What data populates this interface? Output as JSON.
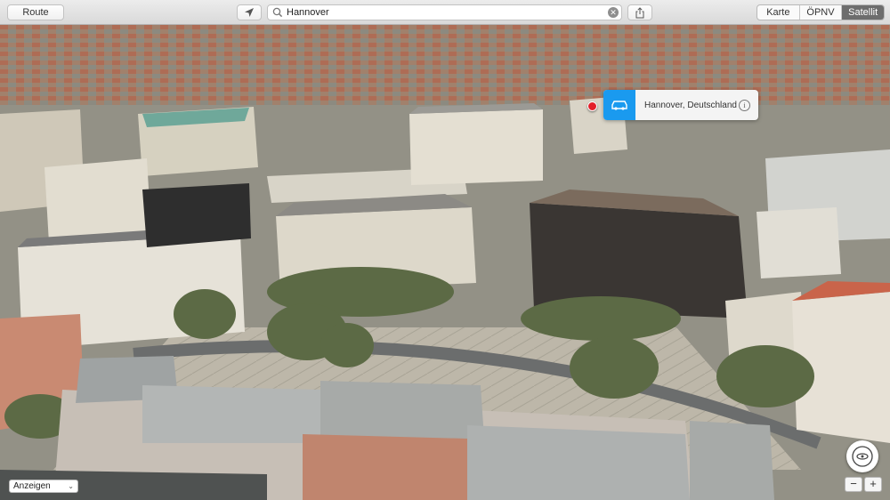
{
  "toolbar": {
    "route_label": "Route",
    "location_icon": "location-arrow-icon",
    "search_value": "Hannover",
    "share_icon": "share-icon",
    "map_types": [
      "Karte",
      "ÖPNV",
      "Satellit"
    ],
    "active_map_type": "Satellit"
  },
  "callout": {
    "title": "Hannover, Deutschland",
    "accent_color": "#1a9aef",
    "icon": "car-icon",
    "info_icon": "info-icon"
  },
  "bottom": {
    "show_label": "Anzeigen",
    "zoom_out": "−",
    "zoom_in": "+",
    "compass_icon": "compass-icon"
  }
}
